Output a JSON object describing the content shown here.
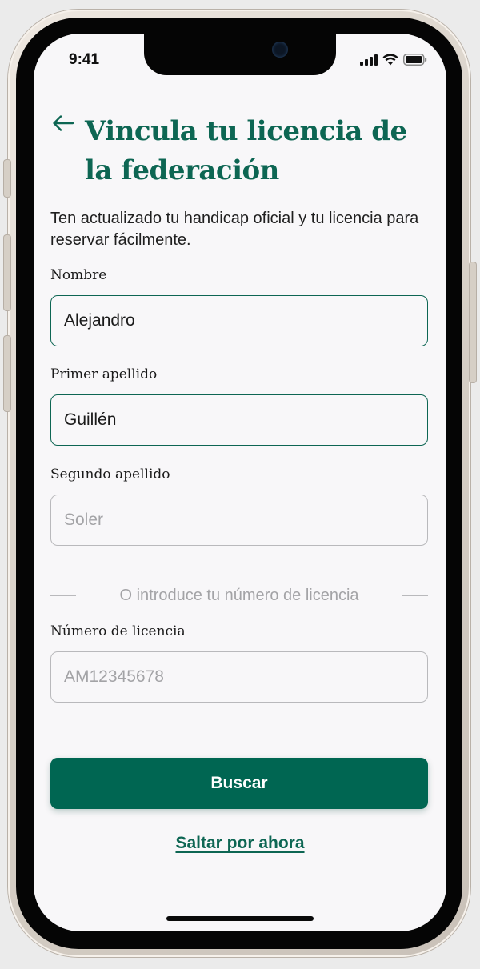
{
  "status_bar": {
    "time": "9:41"
  },
  "header": {
    "back_icon": "arrow-left-icon",
    "title": "Vincula tu licencia de la federación",
    "subtitle": "Ten actualizado tu handicap oficial y tu licencia para reservar fácilmente."
  },
  "form": {
    "nombre": {
      "label": "Nombre",
      "value": "Alejandro"
    },
    "primer_apellido": {
      "label": "Primer apellido",
      "value": "Guillén"
    },
    "segundo_apellido": {
      "label": "Segundo apellido",
      "placeholder": "Soler"
    },
    "divider_text": "O introduce tu número de licencia",
    "licencia": {
      "label": "Número de licencia",
      "placeholder": "AM12345678"
    }
  },
  "actions": {
    "search_label": "Buscar",
    "skip_label": "Saltar por ahora"
  },
  "colors": {
    "brand": "#006652",
    "title": "#0d6653",
    "background": "#f8f7f9",
    "border_empty": "#b9b9bc"
  }
}
